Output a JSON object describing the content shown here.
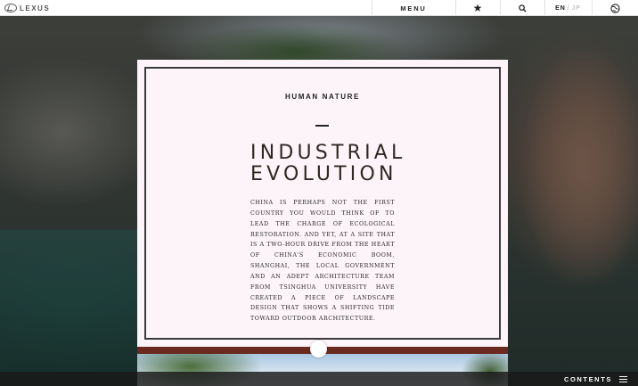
{
  "topbar": {
    "logo_text": "LEXUS",
    "menu_label": "MENU",
    "lang_active": "EN",
    "lang_sep": "/",
    "lang_inactive": "JP"
  },
  "article": {
    "kicker": "HUMAN NATURE",
    "title_line1": "INDUSTRIAL",
    "title_line2": "EVOLUTION",
    "body": "China is perhaps not the first country you would think of to lead the charge of ecological restoration. And yet, at a site that is a two-hour drive from the heart of China's economic boom, Shanghai, the local government and an adept architecture team from Tsinghua University have created a piece of landscape design that shows a shifting tide toward outdoor architecture."
  },
  "footer": {
    "contents_label": "CONTENTS"
  },
  "icons": {
    "logo": "lexus-logo-icon",
    "star": "star-icon",
    "search": "search-icon",
    "globe": "globe-icon",
    "menu": "hamburger-icon"
  },
  "colors": {
    "card_bg": "#fdf4fa",
    "accent_strip": "#6b2a1f",
    "text_dark": "#2f2822"
  }
}
